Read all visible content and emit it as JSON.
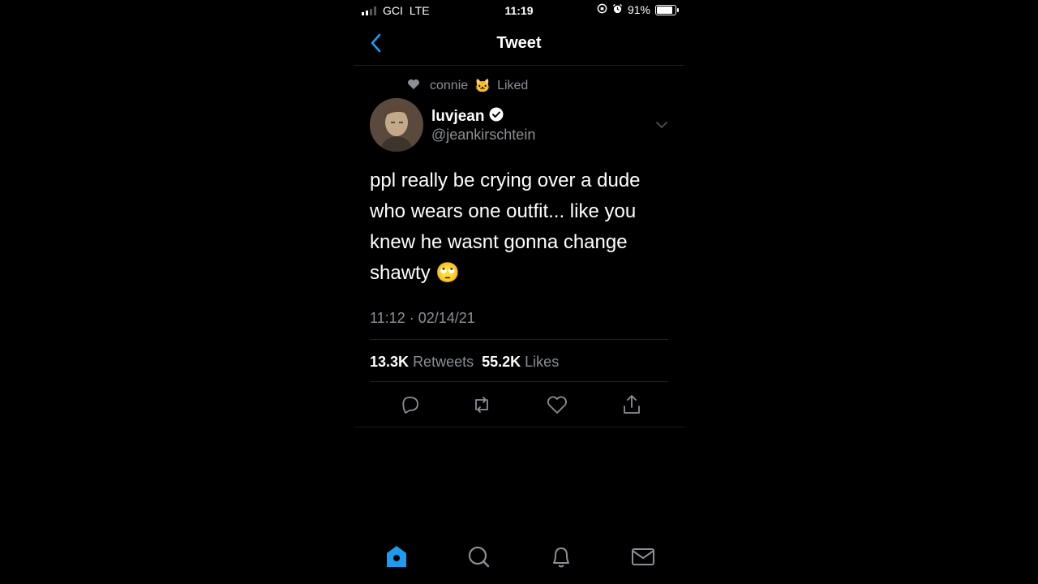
{
  "status_bar": {
    "carrier": "GCI",
    "network": "LTE",
    "time": "11:19",
    "battery": "91%"
  },
  "header": {
    "title": "Tweet"
  },
  "social_context": {
    "name": "connie",
    "emoji": "🐱",
    "action": "Liked"
  },
  "author": {
    "display_name": "luvjean",
    "handle": "@jeankirschtein",
    "verified": true
  },
  "tweet": {
    "text": "ppl really be crying over a dude who wears one outfit... like you knew he wasnt gonna change shawty 🙄",
    "timestamp": "11:12 · 02/14/21"
  },
  "stats": {
    "retweets_count": "13.3K",
    "retweets_label": "Retweets",
    "likes_count": "55.2K",
    "likes_label": "Likes"
  },
  "icons": {
    "back": "chevron-left-icon",
    "reply": "reply-icon",
    "retweet": "retweet-icon",
    "like": "heart-icon",
    "share": "share-icon",
    "home": "home-icon",
    "search": "search-icon",
    "notifications": "bell-icon",
    "messages": "mail-icon"
  },
  "colors": {
    "accent": "#1d9bf0",
    "secondary_text": "#8b8f94",
    "background": "#000000"
  }
}
